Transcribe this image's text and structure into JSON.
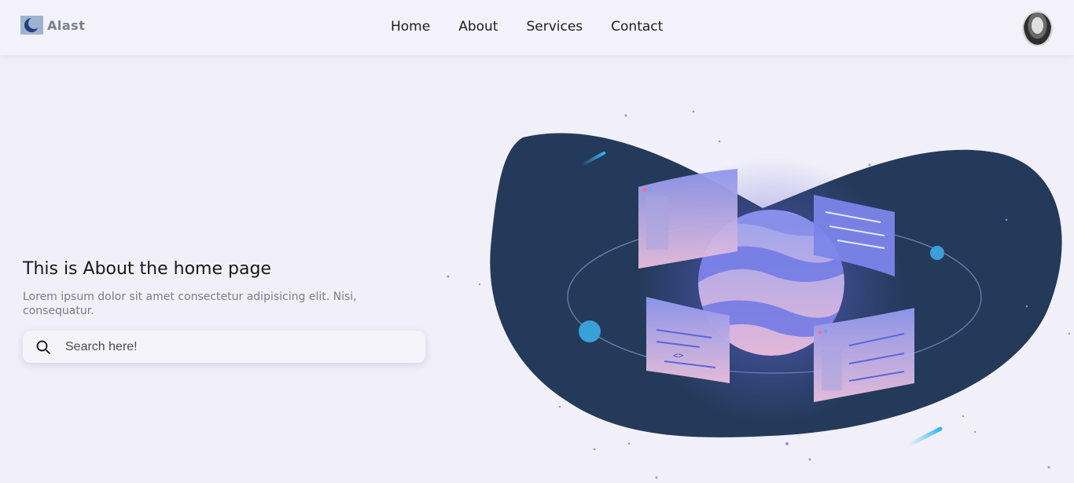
{
  "brand": {
    "name": "Alast",
    "logo_icon": "crescent-logo-icon"
  },
  "nav": {
    "links": [
      {
        "label": "Home"
      },
      {
        "label": "About"
      },
      {
        "label": "Services"
      },
      {
        "label": "Contact"
      }
    ]
  },
  "avatar": {
    "icon": "user-avatar"
  },
  "hero": {
    "title": "This is About the home page",
    "description": "Lorem ipsum dolor sit amet consectetur adipisicing elit. Nisi, consequatur.",
    "search": {
      "placeholder": "Search here!",
      "value": "",
      "icon": "search-icon"
    }
  },
  "colors": {
    "background": "#f1eff8",
    "blob": "#243a5a",
    "accent": "#6c7ae0",
    "text": "#17171f",
    "muted": "#7b7d8a"
  }
}
